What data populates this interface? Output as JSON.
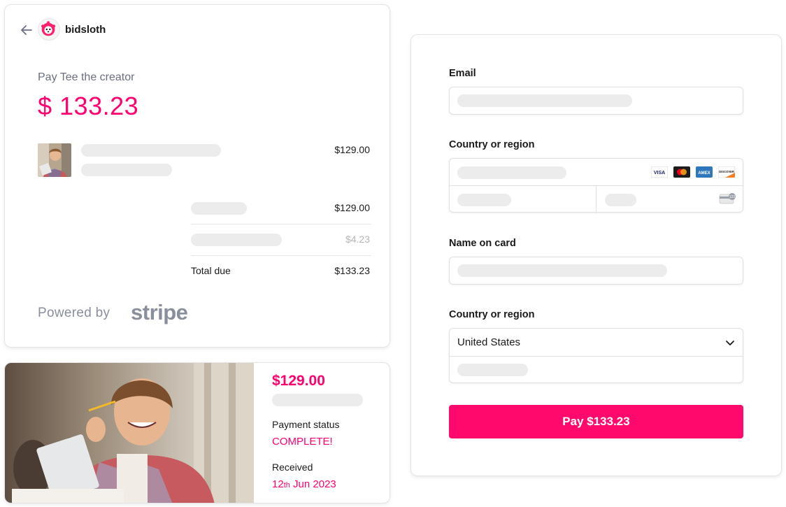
{
  "header": {
    "brand": "bidsloth"
  },
  "summary": {
    "pay_to": "Pay Tee the creator",
    "amount": "$ 133.23",
    "item_price": "$129.00",
    "subtotal": "$129.00",
    "fee": "$4.23",
    "total_label": "Total due",
    "total": "$133.23",
    "powered_by": "Powered by",
    "stripe": "stripe"
  },
  "receipt": {
    "amount": "$129.00",
    "status_label": "Payment status",
    "status_value": "COMPLETE!",
    "received_label": "Received",
    "received_day": "12",
    "received_suffix": "th",
    "received_rest": " Jun 2023"
  },
  "form": {
    "email_label": "Email",
    "card_label": "Country or region",
    "name_label": "Name on card",
    "country_label": "Country or region",
    "country_value": "United States",
    "pay_button": "Pay $133.23",
    "card_brands": [
      "visa-icon",
      "mastercard-icon",
      "amex-icon",
      "discover-icon"
    ]
  },
  "colors": {
    "accent": "#ff006e",
    "button": "#ff0a6c",
    "muted": "#8a8f9c",
    "skeleton": "#ececec"
  }
}
